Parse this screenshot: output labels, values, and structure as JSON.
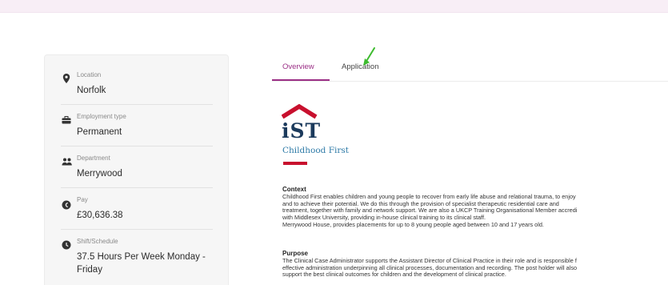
{
  "sidebar": {
    "items": [
      {
        "icon": "location-pin-icon",
        "label": "Location",
        "value": "Norfolk"
      },
      {
        "icon": "briefcase-icon",
        "label": "Employment type",
        "value": "Permanent"
      },
      {
        "icon": "people-icon",
        "label": "Department",
        "value": "Merrywood"
      },
      {
        "icon": "currency-icon",
        "label": "Pay",
        "value": "£30,636.38"
      },
      {
        "icon": "clock-icon",
        "label": "Shift/Schedule",
        "value_lines": [
          "37.5 Hours Per Week Monday -",
          "Friday"
        ]
      }
    ]
  },
  "tabs": [
    {
      "label": "Overview",
      "active": true
    },
    {
      "label": "Application",
      "active": false
    }
  ],
  "logo": {
    "wordmark": "iST",
    "subtitle": "Childhood First"
  },
  "content": {
    "context": {
      "title": "Context",
      "lines": [
        "Childhood First enables children and young people to recover from early life abuse and relational trauma, to enjoy",
        "and to achieve their potential. We do this through the provision of specialist therapeutic residential care and",
        "treatment, together with family and network support. We are also a UKCP Training Organisational Member accredi",
        "with Middlesex University, providing in-house clinical training to its clinical staff.",
        "Merrywood House, provides placements for up to 8 young people aged between 10 and 17 years old."
      ]
    },
    "purpose": {
      "title": "Purpose",
      "lines": [
        "The Clinical Case Administrator supports the Assistant Director of Clinical Practice in their role and is responsible f",
        "effective administration underpinning all clinical processes, documentation and recording. The post holder will also",
        "support the best clinical outcomes for children and the development of clinical practice."
      ]
    }
  },
  "colors": {
    "accent": "#9b2f86",
    "logo_red": "#c8102e",
    "logo_navy": "#1b3a5c",
    "logo_blue": "#2d7aa7",
    "annotation_arrow": "#3dbb2e"
  }
}
